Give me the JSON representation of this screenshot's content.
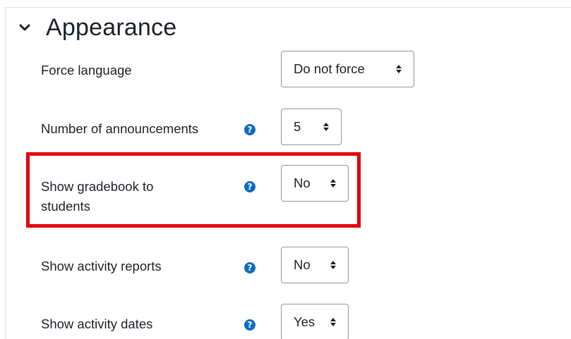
{
  "section": {
    "title": "Appearance"
  },
  "settings": [
    {
      "label": "Force language",
      "value": "Do not force",
      "has_help": false
    },
    {
      "label": "Number of announcements",
      "value": "5",
      "has_help": true
    },
    {
      "label": "Show gradebook to students",
      "value": "No",
      "has_help": true
    },
    {
      "label": "Show activity reports",
      "value": "No",
      "has_help": true
    },
    {
      "label": "Show activity dates",
      "value": "Yes",
      "has_help": true
    }
  ],
  "icons": {
    "collapse": "chevron-down-icon",
    "help": "question-circle-icon",
    "select_caret": "sort-caret-icon"
  },
  "colors": {
    "help_icon": "#0f6cbf",
    "highlight": "#e3000b",
    "select_border": "#8f959e",
    "section_border": "#dee2e6"
  }
}
